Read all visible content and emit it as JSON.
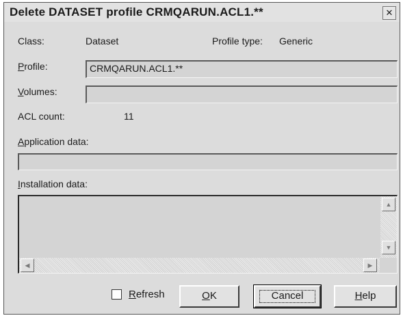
{
  "window": {
    "title": "Delete DATASET profile CRMQARUN.ACL1.**",
    "close_symbol": "✕"
  },
  "class": {
    "label": "Class:",
    "value": "Dataset"
  },
  "profile_type": {
    "label": "Profile type:",
    "value": "Generic"
  },
  "profile": {
    "label_key": "P",
    "label_rest": "rofile:",
    "value": "CRMQARUN.ACL1.**"
  },
  "volumes": {
    "label_key": "V",
    "label_rest": "olumes:",
    "value": ""
  },
  "acl_count": {
    "label": "ACL count:",
    "value": "11"
  },
  "application_data": {
    "label_key": "A",
    "label_rest": "pplication data:",
    "value": ""
  },
  "installation_data": {
    "label_key": "I",
    "label_rest": "nstallation data:",
    "value": ""
  },
  "refresh": {
    "label_key": "R",
    "label_rest": "efresh",
    "checked": false
  },
  "buttons": {
    "ok": {
      "key": "O",
      "rest": "K"
    },
    "cancel": {
      "label": "Cancel"
    },
    "help": {
      "key": "H",
      "rest": "elp"
    }
  },
  "scroll_icons": {
    "up": "▲",
    "down": "▼",
    "left": "◀",
    "right": "▶"
  }
}
